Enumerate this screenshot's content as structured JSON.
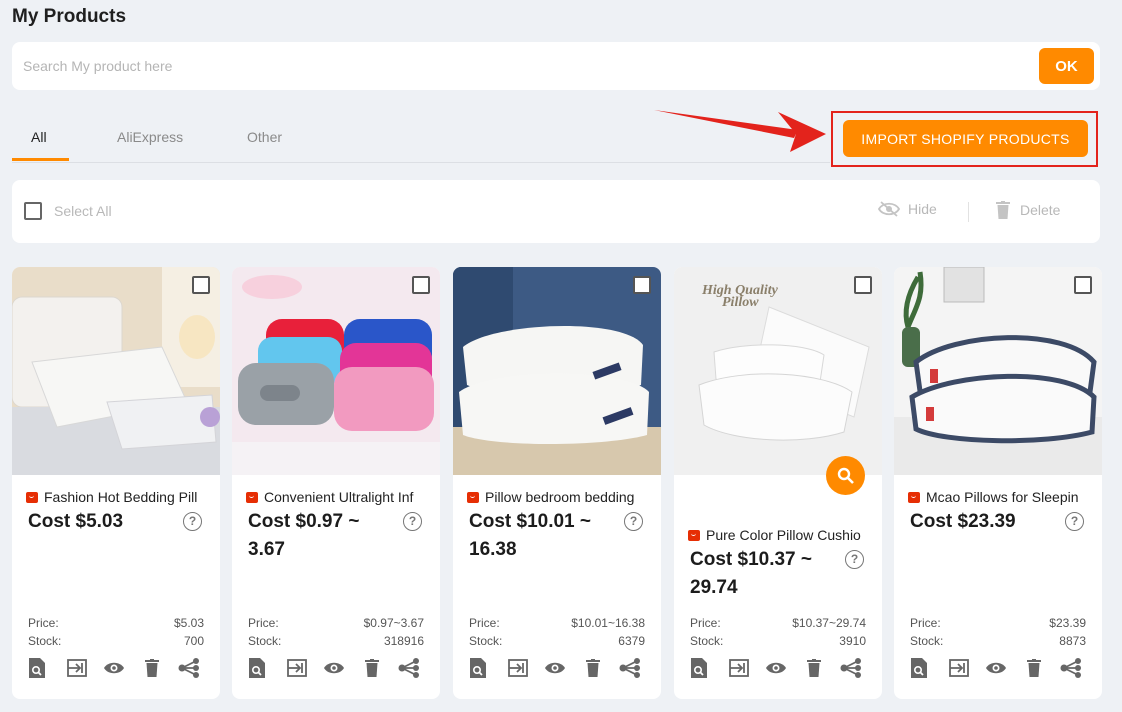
{
  "page": {
    "title": "My Products"
  },
  "search": {
    "placeholder": "Search My product here",
    "value": "",
    "ok_label": "OK"
  },
  "tabs": [
    {
      "label": "All",
      "active": true
    },
    {
      "label": "AliExpress",
      "active": false
    },
    {
      "label": "Other",
      "active": false
    }
  ],
  "import_button": {
    "label": "IMPORT SHOPIFY PRODUCTS"
  },
  "toolbar": {
    "select_all_label": "Select All",
    "hide_label": "Hide",
    "delete_label": "Delete"
  },
  "labels": {
    "price": "Price:",
    "stock": "Stock:"
  },
  "colors": {
    "accent": "#ff8a00",
    "annotation": "#e3231c",
    "aliexpress": "#e62e04"
  },
  "products": [
    {
      "title": "Fashion Hot Bedding Pill",
      "cost_line1": "Cost $5.03",
      "cost_line2": "",
      "price": "$5.03",
      "stock": "700",
      "has_zoom": false
    },
    {
      "title": "Convenient Ultralight Inf",
      "cost_line1": "Cost $0.97 ~",
      "cost_line2": "3.67",
      "price": "$0.97~3.67",
      "stock": "318916",
      "has_zoom": false
    },
    {
      "title": "Pillow bedroom bedding",
      "cost_line1": "Cost $10.01 ~",
      "cost_line2": "16.38",
      "price": "$10.01~16.38",
      "stock": "6379",
      "has_zoom": false
    },
    {
      "title": "Pure Color Pillow Cushio",
      "cost_line1": "Cost $10.37 ~",
      "cost_line2": "29.74",
      "price": "$10.37~29.74",
      "stock": "3910",
      "has_zoom": true,
      "image_text_line1": "High Quality",
      "image_text_line2": "Pillow"
    },
    {
      "title": "Mcao Pillows for Sleepin",
      "cost_line1": "Cost $23.39",
      "cost_line2": "",
      "price": "$23.39",
      "stock": "8873",
      "has_zoom": false
    }
  ],
  "icons": [
    "search-detail-icon",
    "push-to-store-icon",
    "eye-icon",
    "trash-icon",
    "share-icon"
  ]
}
